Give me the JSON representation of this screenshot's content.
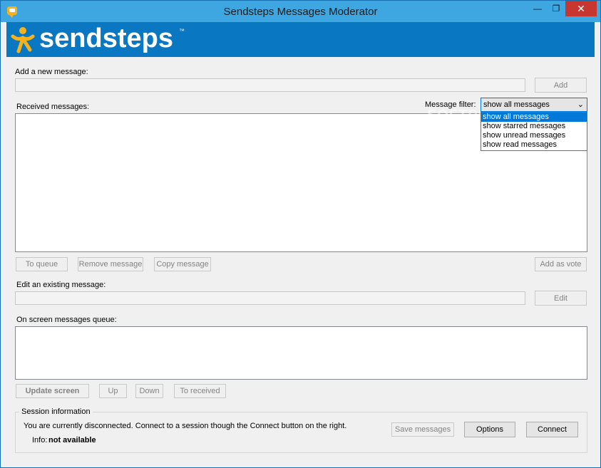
{
  "window": {
    "title": "Sendsteps Messages Moderator",
    "minimize": "—",
    "maximize": "❐",
    "close": "✕"
  },
  "banner": {
    "logo_text": "sendsteps",
    "logo_tm": "™"
  },
  "add": {
    "label": "Add a new message:",
    "value": "",
    "button": "Add"
  },
  "received": {
    "label": "Received messages:",
    "filter_label": "Message filter:",
    "filter_selected": "show all messages",
    "filter_options": [
      "show all messages",
      "show starred messages",
      "show unread messages",
      "show read messages"
    ],
    "items": []
  },
  "actions": {
    "to_queue": "To queue",
    "remove": "Remove message",
    "copy": "Copy message",
    "add_vote": "Add as vote"
  },
  "edit": {
    "label": "Edit an existing message:",
    "value": "",
    "button": "Edit"
  },
  "queue": {
    "label": "On screen messages queue:",
    "items": [],
    "update": "Update screen",
    "up": "Up",
    "down": "Down",
    "to_received": "To received"
  },
  "session": {
    "title": "Session information",
    "status": "You are currently disconnected. Connect to a session though the Connect button on the right.",
    "info_label": "Info:",
    "info_value": "not available",
    "save": "Save messages",
    "options": "Options",
    "connect": "Connect"
  },
  "colors": {
    "accent": "#0078d7",
    "banner": "#0a77c2",
    "titlebar": "#3ea6e0",
    "logo_figure": "#f6b21b"
  }
}
